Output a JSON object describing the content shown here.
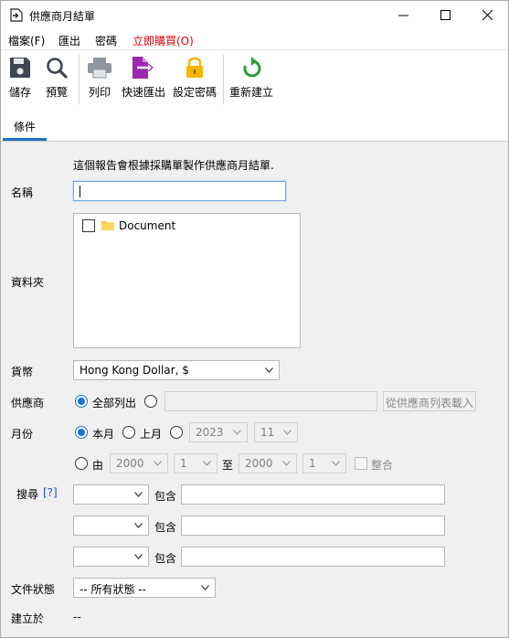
{
  "window": {
    "title": "供應商月結單",
    "minimize_icon": "minimize-icon",
    "maximize_icon": "maximize-icon",
    "close_icon": "close-icon"
  },
  "menu": {
    "file": "檔案(F)",
    "export": "匯出",
    "password": "密碼",
    "buy_now": "立即購買(O)"
  },
  "toolbar": {
    "save": "儲存",
    "preview": "預覽",
    "print": "列印",
    "quick_export": "快速匯出",
    "set_password": "設定密碼",
    "rebuild": "重新建立"
  },
  "tab": {
    "label": "條件"
  },
  "form": {
    "description": "這個報告會根據採購單製作供應商月結單.",
    "name_label": "名稱",
    "name_value": "",
    "folder_label": "資料夾",
    "folder_item": "Document",
    "currency_label": "貨幣",
    "currency_value": "Hong Kong Dollar, $",
    "supplier_label": "供應商",
    "supplier_all": "全部列出",
    "supplier_load": "從供應商列表載入",
    "month_label": "月份",
    "this_month": "本月",
    "last_month": "上月",
    "year_value": "2023",
    "month_value": "11",
    "from_label": "由",
    "from_year": "2000",
    "from_month": "1",
    "to_label": "至",
    "to_year": "2000",
    "to_month": "1",
    "consolidate": "整合",
    "search_label": "搜尋",
    "search_help": "[?]",
    "contains": "包含",
    "status_label": "文件狀態",
    "status_value": "-- 所有狀態 --",
    "created_label": "建立於",
    "created_value": "--"
  },
  "colors": {
    "accent": "#1a73d9",
    "buy_now": "#e0000b",
    "export_icon": "#9c27b0",
    "lock_icon": "#f5b400",
    "rebuild_icon": "#2e9b3e"
  }
}
